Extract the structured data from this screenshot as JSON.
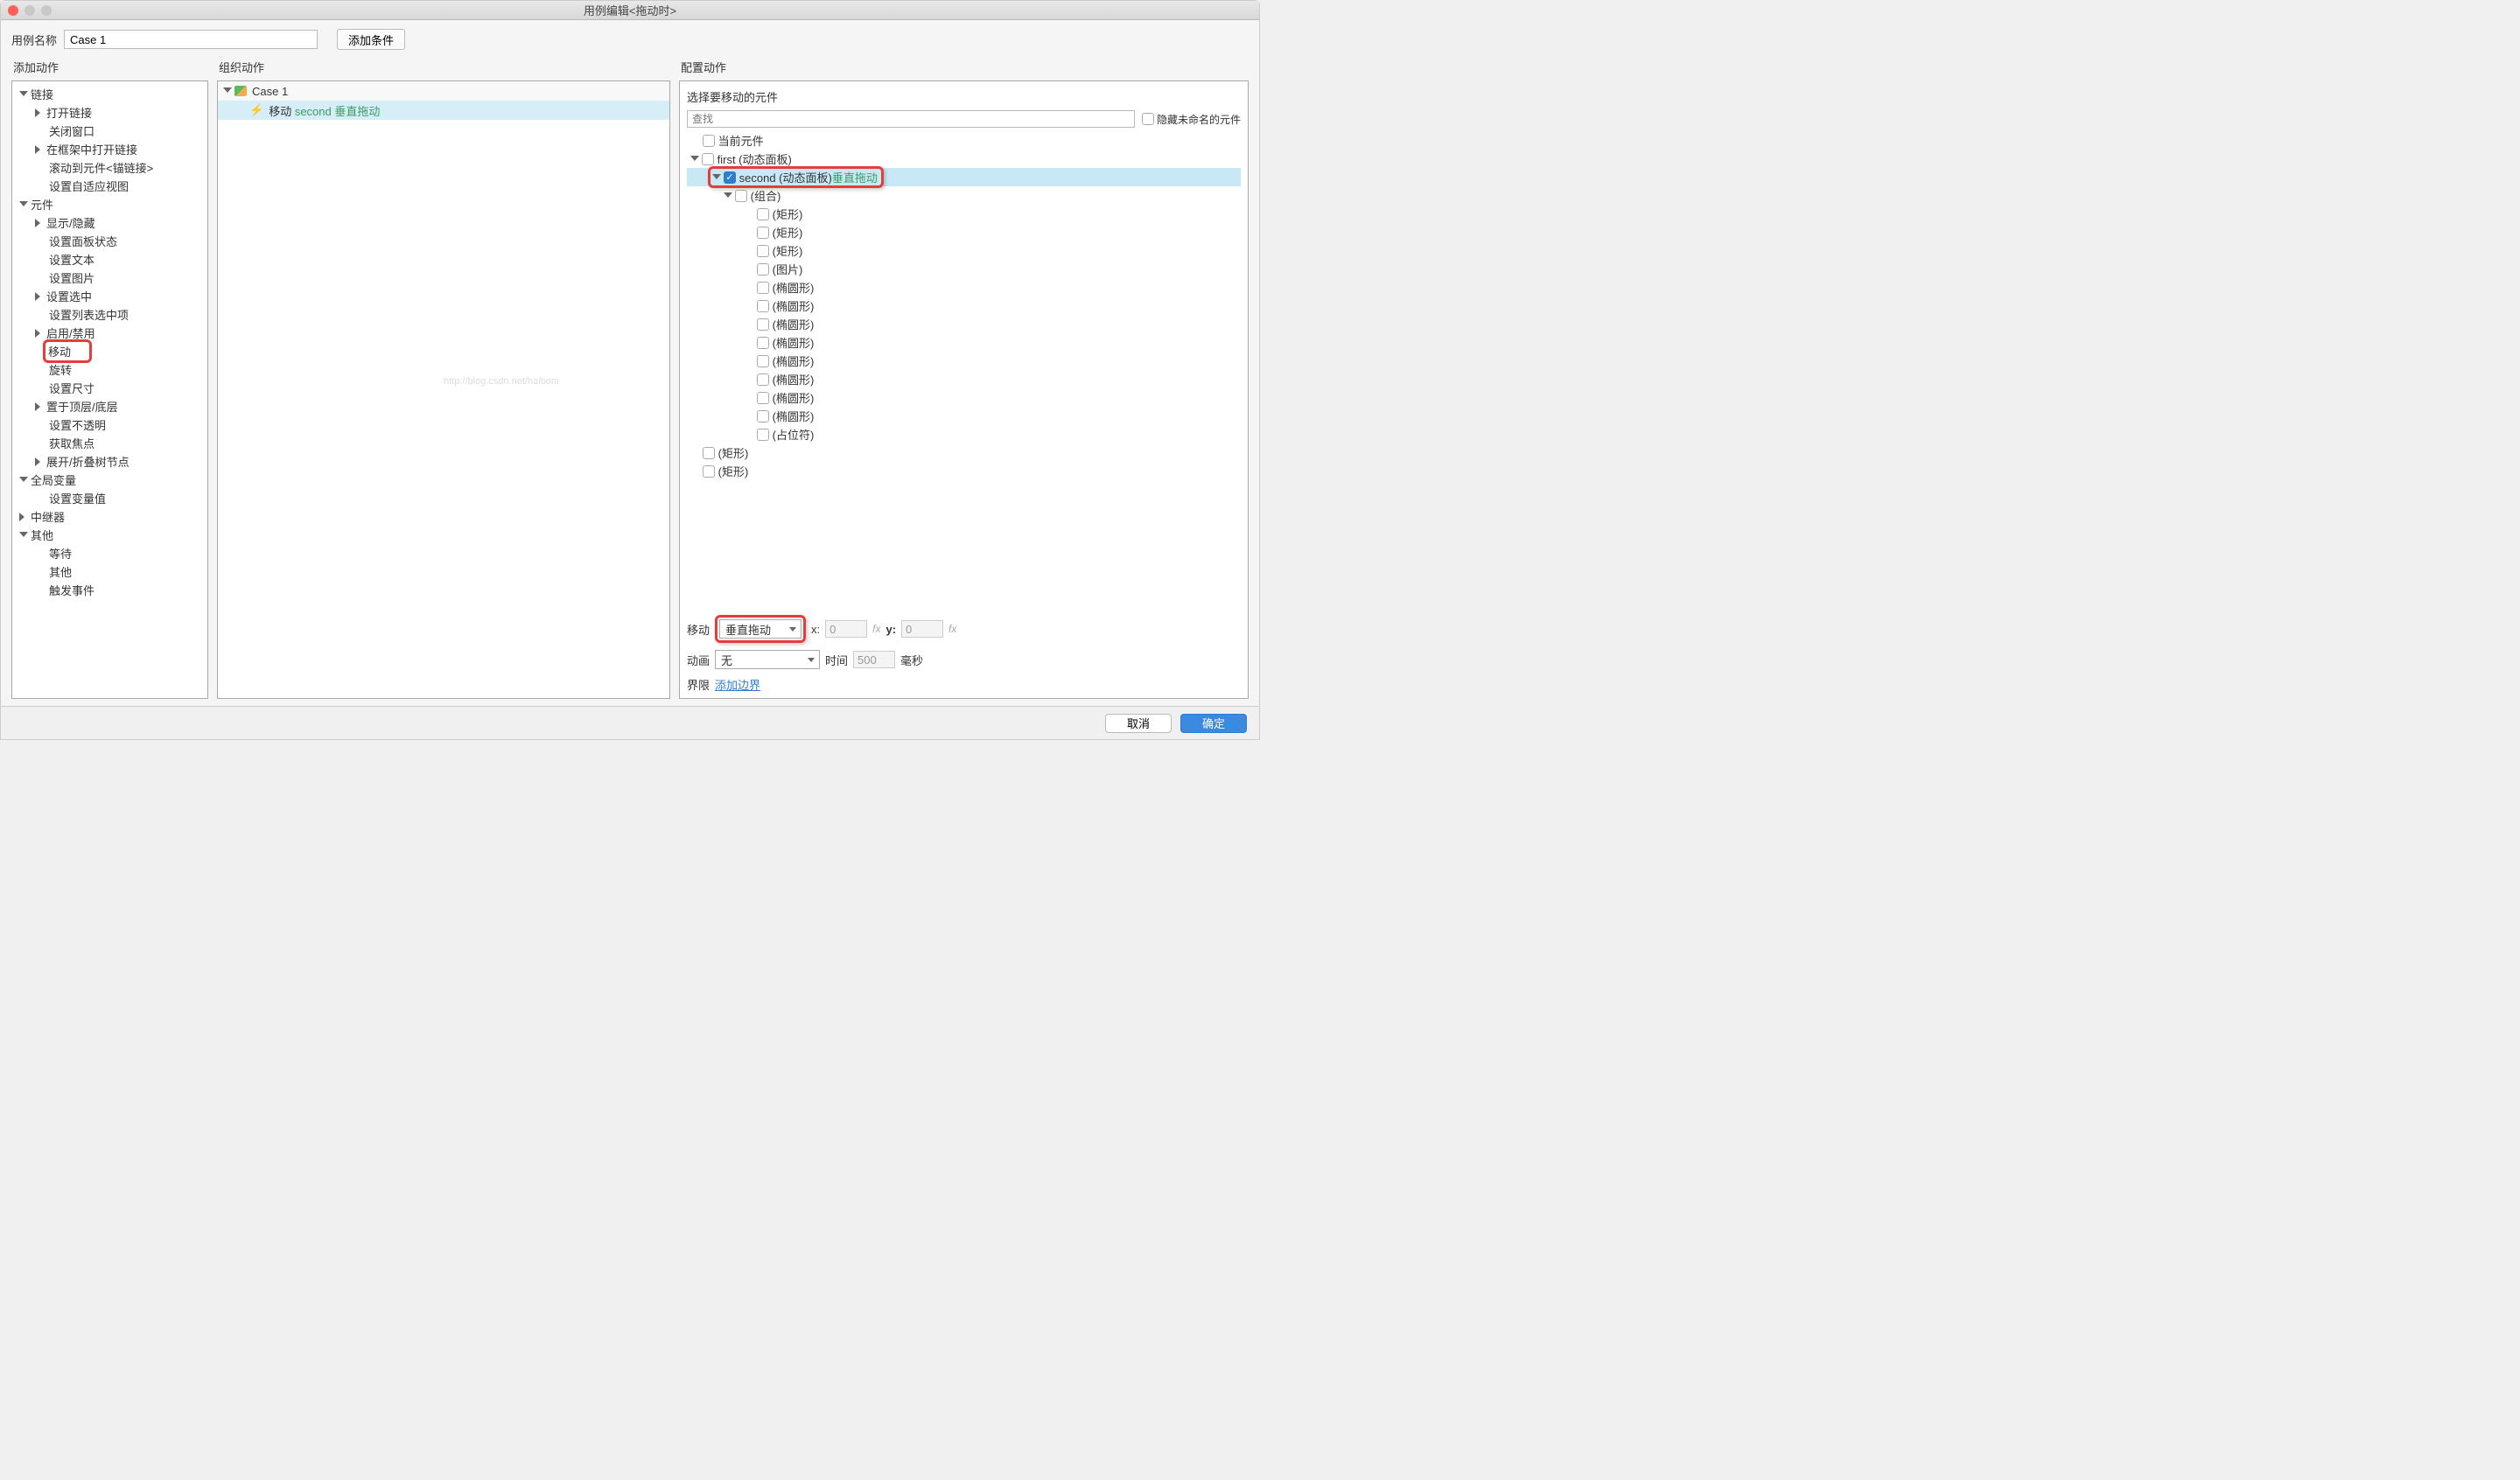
{
  "window_title": "用例编辑<拖动时>",
  "top": {
    "case_name_label": "用例名称",
    "case_name_value": "Case 1",
    "add_condition": "添加条件"
  },
  "panels": {
    "add_actions": "添加动作",
    "organize_actions": "组织动作",
    "configure_actions": "配置动作"
  },
  "action_tree": {
    "link": {
      "label": "链接",
      "items": [
        "打开链接",
        "关闭窗口",
        "在框架中打开链接",
        "滚动到元件<锚链接>",
        "设置自适应视图"
      ],
      "expandable": [
        true,
        false,
        true,
        false,
        false
      ]
    },
    "widget": {
      "label": "元件",
      "items": [
        "显示/隐藏",
        "设置面板状态",
        "设置文本",
        "设置图片",
        "设置选中",
        "设置列表选中项",
        "启用/禁用",
        "移动",
        "旋转",
        "设置尺寸",
        "置于顶层/底层",
        "设置不透明",
        "获取焦点",
        "展开/折叠树节点"
      ],
      "expandable": [
        true,
        false,
        false,
        false,
        true,
        false,
        true,
        false,
        false,
        false,
        true,
        false,
        false,
        true
      ],
      "highlight": 7
    },
    "global_vars": {
      "label": "全局变量",
      "items": [
        "设置变量值"
      ]
    },
    "repeater": {
      "label": "中继器"
    },
    "other": {
      "label": "其他",
      "items": [
        "等待",
        "其他",
        "触发事件"
      ]
    }
  },
  "org": {
    "case_name": "Case 1",
    "action_prefix": "移动 ",
    "action_target": "second ",
    "action_suffix": "垂直拖动"
  },
  "cfg": {
    "subtitle": "选择要移动的元件",
    "search_placeholder": "查找",
    "hide_unnamed": "隐藏未命名的元件",
    "widgets": {
      "current": "当前元件",
      "first": "first (动态面板)",
      "second_name": "second (动态面板) ",
      "second_suffix": "垂直拖动",
      "group": "(组合)",
      "shapes": [
        "(矩形)",
        "(矩形)",
        "(矩形)",
        "(图片)",
        "(椭圆形)",
        "(椭圆形)",
        "(椭圆形)",
        "(椭圆形)",
        "(椭圆形)",
        "(椭圆形)",
        "(椭圆形)",
        "(椭圆形)",
        "(占位符)"
      ],
      "rect1": "(矩形)",
      "rect2": "(矩形)"
    },
    "move_label": "移动",
    "move_value": "垂直拖动",
    "x_label": "x:",
    "x_value": "0",
    "y_label": "y:",
    "y_value": "0",
    "fx": "fx",
    "anim_label": "动画",
    "anim_value": "无",
    "time_label": "时间",
    "time_value": "500",
    "ms": "毫秒",
    "bounds_label": "界限",
    "bounds_link": "添加边界"
  },
  "footer": {
    "cancel": "取消",
    "ok": "确定"
  },
  "watermark": "http://blog.csdn.net/haibom"
}
